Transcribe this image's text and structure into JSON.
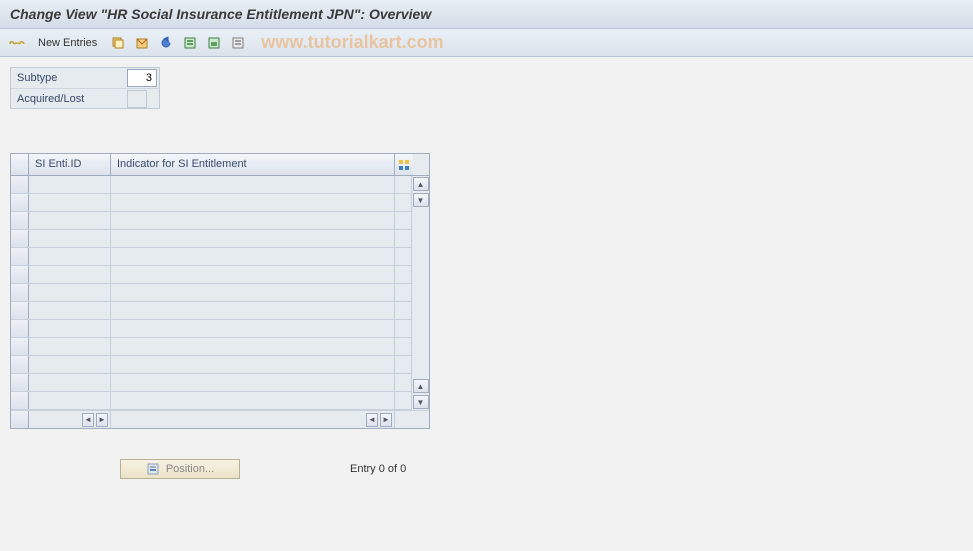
{
  "title": "Change View \"HR Social Insurance Entitlement JPN\": Overview",
  "toolbar": {
    "new_entries_label": "New Entries"
  },
  "watermark": "www.tutorialkart.com",
  "fields": {
    "subtype_label": "Subtype",
    "subtype_value": "3",
    "acquired_lost_label": "Acquired/Lost",
    "acquired_lost_value": ""
  },
  "table": {
    "columns": {
      "col1": "SI Enti.ID",
      "col2": "Indicator for SI Entitlement"
    },
    "rows": []
  },
  "footer": {
    "position_label": "Position...",
    "entry_text": "Entry 0 of 0"
  }
}
